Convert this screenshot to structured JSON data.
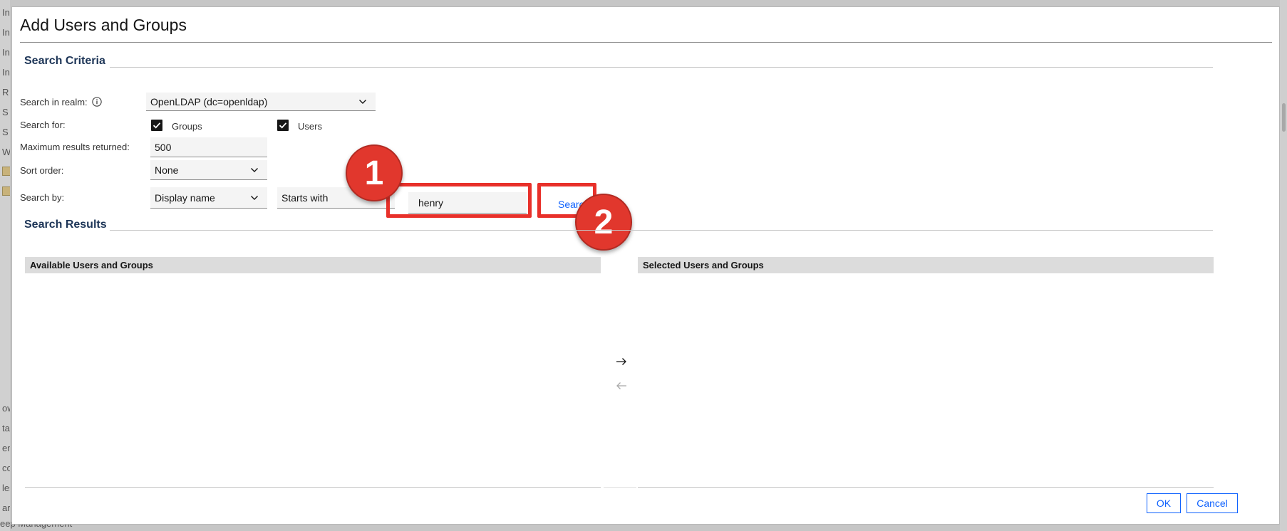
{
  "background": {
    "left_letters": [
      "In",
      "In",
      "In",
      "In",
      "R",
      "S",
      "S",
      "W"
    ],
    "left_letters_lower": [
      "ow",
      "ta",
      "en",
      "co",
      "les",
      "ar"
    ],
    "bottom_text": "eep Management"
  },
  "dialog": {
    "title": "Add Users and Groups"
  },
  "search_criteria": {
    "title": "Search Criteria",
    "realm_label": "Search in realm:",
    "realm_value": "OpenLDAP (dc=openldap)",
    "search_for_label": "Search for:",
    "groups_label": "Groups",
    "groups_checked": true,
    "users_label": "Users",
    "users_checked": true,
    "max_results_label": "Maximum results returned:",
    "max_results_value": "500",
    "sort_order_label": "Sort order:",
    "sort_order_value": "None",
    "search_by_label": "Search by:",
    "search_by_value": "Display name",
    "match_value": "Starts with",
    "search_text_value": "henry",
    "search_button": "Search"
  },
  "search_results": {
    "title": "Search Results",
    "available_header": "Available Users and Groups",
    "selected_header": "Selected Users and Groups"
  },
  "annotations": {
    "marker_1": "1",
    "marker_2": "2",
    "highlight_color": "#e8302a"
  },
  "footer": {
    "ok_label": "OK",
    "cancel_label": "Cancel"
  },
  "colors": {
    "accent": "#0f62fe",
    "marker": "#e1372d"
  }
}
